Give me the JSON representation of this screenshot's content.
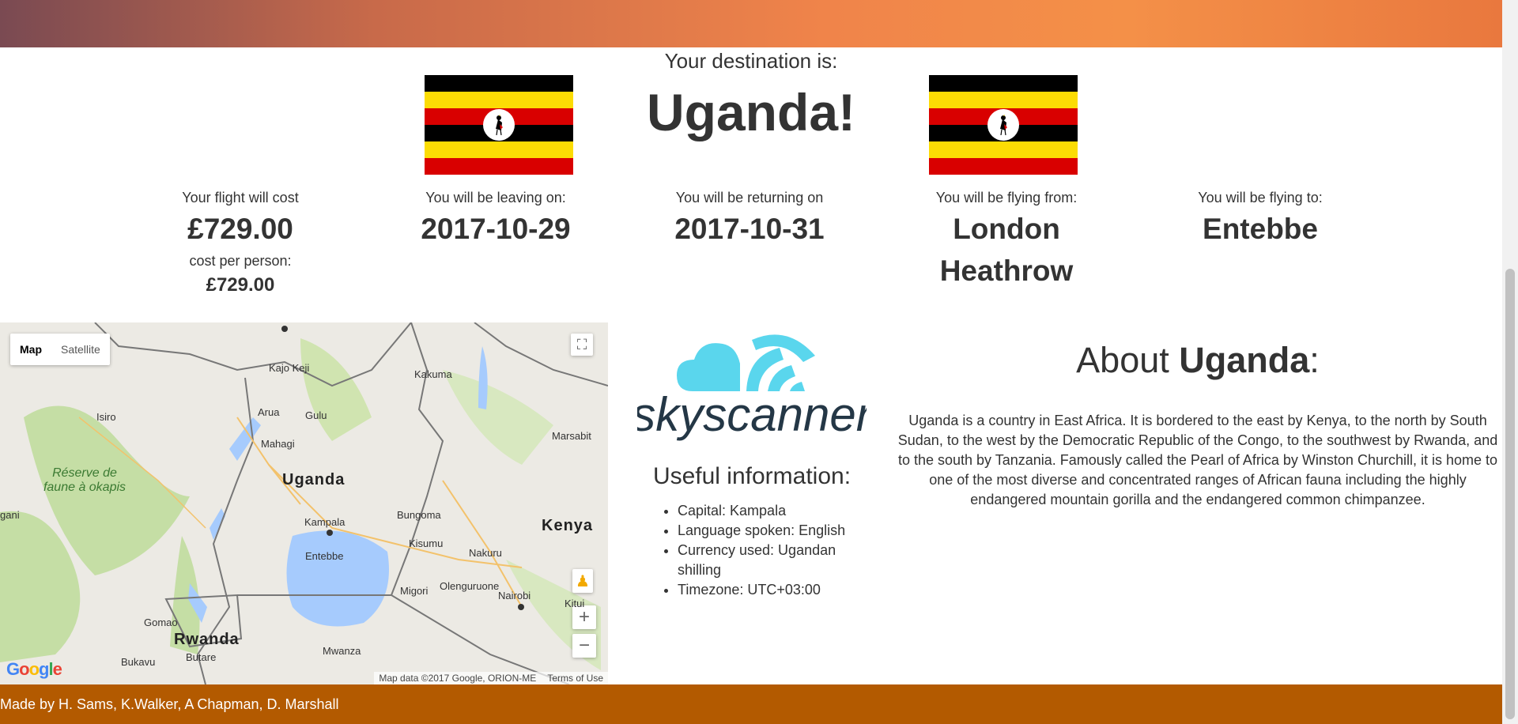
{
  "destination": {
    "label": "Your destination is:",
    "country": "Uganda!"
  },
  "flight": {
    "cost_label": "Your flight will cost",
    "cost": "£729.00",
    "per_person_label": "cost per person:",
    "per_person": "£729.00",
    "leaving_label": "You will be leaving on:",
    "leaving": "2017-10-29",
    "returning_label": "You will be returning on",
    "returning": "2017-10-31",
    "from_label": "You will be flying from:",
    "from": "London Heathrow",
    "to_label": "You will be flying to:",
    "to": "Entebbe"
  },
  "map": {
    "type_map": "Map",
    "type_satellite": "Satellite",
    "labels": {
      "uganda": "Uganda",
      "kenya": "Kenya",
      "rwanda": "Rwanda",
      "reserve": "Réserve de faune à okapis",
      "kajo_keji": "Kajo Keji",
      "kakuma": "Kakuma",
      "arua": "Arua",
      "gulu": "Gulu",
      "isiro": "Isiro",
      "mahagi": "Mahagi",
      "marsabit": "Marsabit",
      "kampala": "Kampala",
      "bungoma": "Bungoma",
      "entebbe": "Entebbe",
      "kisumu": "Kisumu",
      "nakuru": "Nakuru",
      "migori": "Migori",
      "olenguruone": "Olenguruone",
      "nairobi": "Nairobi",
      "kitui": "Kitui",
      "gomao": "Gomao",
      "bukavu": "Bukavu",
      "butare": "Butare",
      "mwanza": "Mwanza",
      "gani": "gani"
    },
    "attribution": "Map data ©2017 Google, ORION-ME",
    "terms": "Terms of Use",
    "google": "Google"
  },
  "useful": {
    "title": "Useful information:",
    "items": [
      "Capital: Kampala",
      "Language spoken: English",
      "Currency used: Ugandan shilling",
      "Timezone: UTC+03:00"
    ]
  },
  "about": {
    "title_prefix": "About ",
    "title_country": "Uganda",
    "title_suffix": ":",
    "text": "Uganda is a country in East Africa. It is bordered to the east by Kenya, to the north by South Sudan, to the west by the Democratic Republic of the Congo, to the southwest by Rwanda, and to the south by Tanzania. Famously called the Pearl of Africa by Winston Churchill, it is home to one of the most diverse and concentrated ranges of African fauna including the highly endangered mountain gorilla and the endangered common chimpanzee."
  },
  "footer": {
    "credits": "Made by H. Sams, K.Walker, A Chapman, D. Marshall"
  },
  "colors": {
    "footer": "#b35a00",
    "flag_black": "#000000",
    "flag_yellow": "#fcdc04",
    "flag_red": "#d90000",
    "skyscanner_cloud": "#5ad6ed",
    "skyscanner_text": "#243746"
  }
}
